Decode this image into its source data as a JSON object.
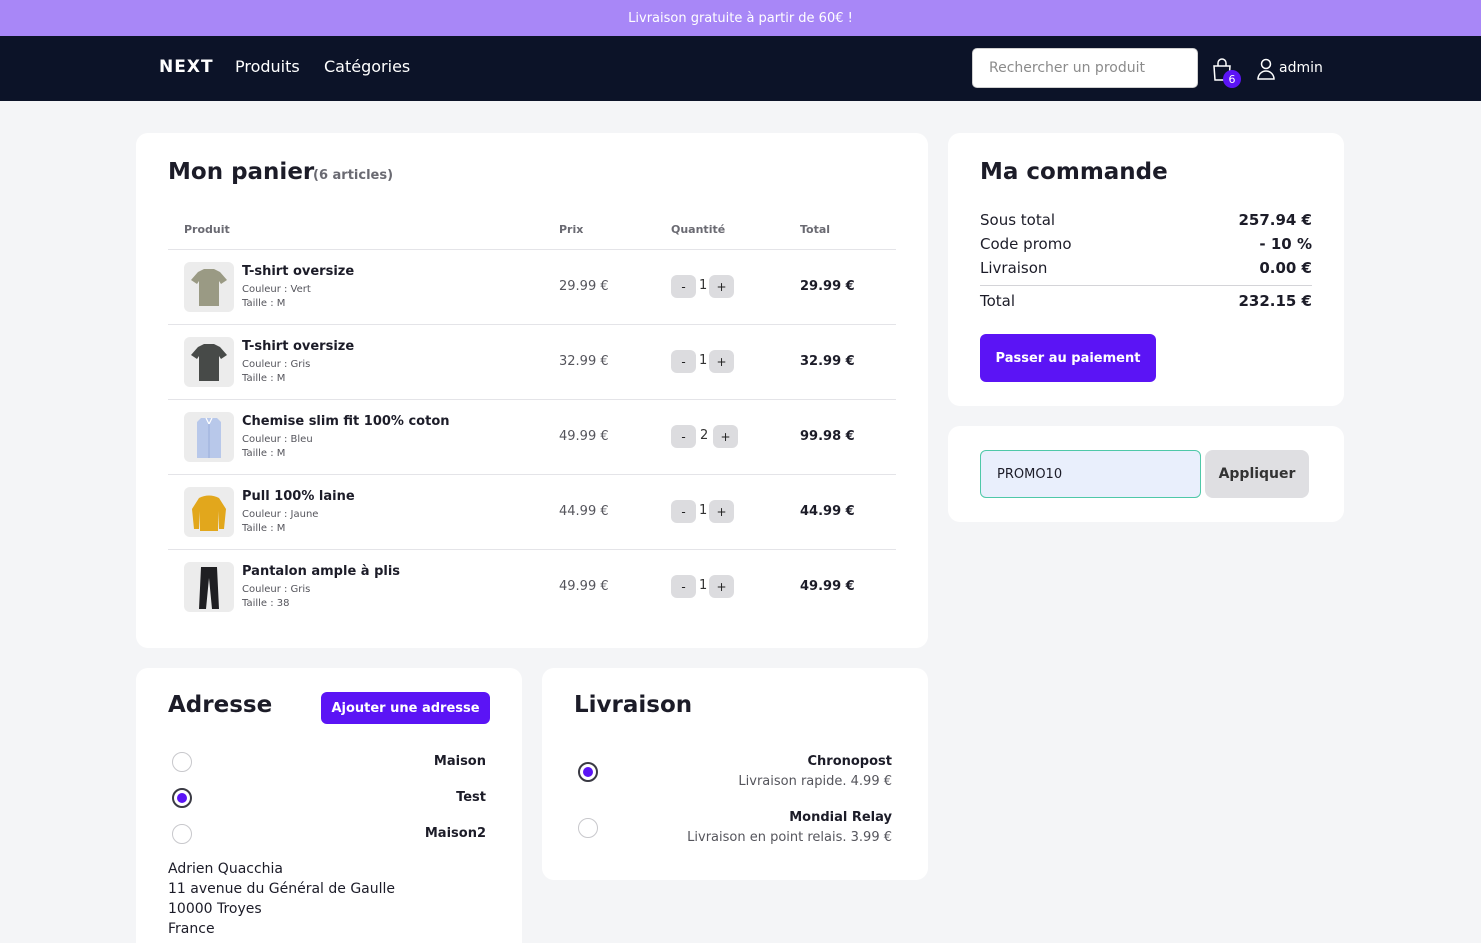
{
  "banner": {
    "text": "Livraison gratuite à partir de 60€ !"
  },
  "nav": {
    "logo": "NEXT",
    "links": [
      "Produits",
      "Catégories"
    ],
    "search_placeholder": "Rechercher un produit",
    "cart_count": "6",
    "user": "admin"
  },
  "cart": {
    "title": "Mon panier",
    "count": "(6 articles)",
    "headers": {
      "product": "Produit",
      "price": "Prix",
      "quantity": "Quantité",
      "total": "Total"
    },
    "items": [
      {
        "name": "T-shirt oversize",
        "color": "Couleur : Vert",
        "size": "Taille : M",
        "price": "29.99 €",
        "qty": "1",
        "total": "29.99 €"
      },
      {
        "name": "T-shirt oversize",
        "color": "Couleur : Gris",
        "size": "Taille : M",
        "price": "32.99 €",
        "qty": "1",
        "total": "32.99 €"
      },
      {
        "name": "Chemise slim fit 100% coton",
        "color": "Couleur : Bleu",
        "size": "Taille : M",
        "price": "49.99 €",
        "qty": "2",
        "total": "99.98 €"
      },
      {
        "name": "Pull 100% laine",
        "color": "Couleur : Jaune",
        "size": "Taille : M",
        "price": "44.99 €",
        "qty": "1",
        "total": "44.99 €"
      },
      {
        "name": "Pantalon ample à plis",
        "color": "Couleur : Gris",
        "size": "Taille : 38",
        "price": "49.99 €",
        "qty": "1",
        "total": "49.99 €"
      }
    ],
    "minus": "-",
    "plus": "+"
  },
  "order": {
    "title": "Ma commande",
    "subtotal_label": "Sous total",
    "subtotal": "257.94 €",
    "promo_label": "Code promo",
    "promo": "- 10 %",
    "shipping_label": "Livraison",
    "shipping": "0.00 €",
    "total_label": "Total",
    "total": "232.15 €",
    "pay_button": "Passer au paiement"
  },
  "promo": {
    "value": "PROMO10",
    "button": "Appliquer"
  },
  "address": {
    "title": "Adresse",
    "add_button": "Ajouter une adresse",
    "options": [
      "Maison",
      "Test",
      "Maison2"
    ],
    "selected": 1,
    "lines": [
      "Adrien Quacchia",
      "11 avenue du Général de Gaulle",
      "10000 Troyes",
      "France"
    ]
  },
  "shipping": {
    "title": "Livraison",
    "options": [
      {
        "name": "Chronopost",
        "desc": "Livraison rapide. 4.99 €"
      },
      {
        "name": "Mondial Relay",
        "desc": "Livraison en point relais. 3.99 €"
      }
    ],
    "selected": 0
  },
  "colors": {
    "accent": "#5b14f5",
    "banner": "#a887f7",
    "navbar": "#0c1328"
  }
}
